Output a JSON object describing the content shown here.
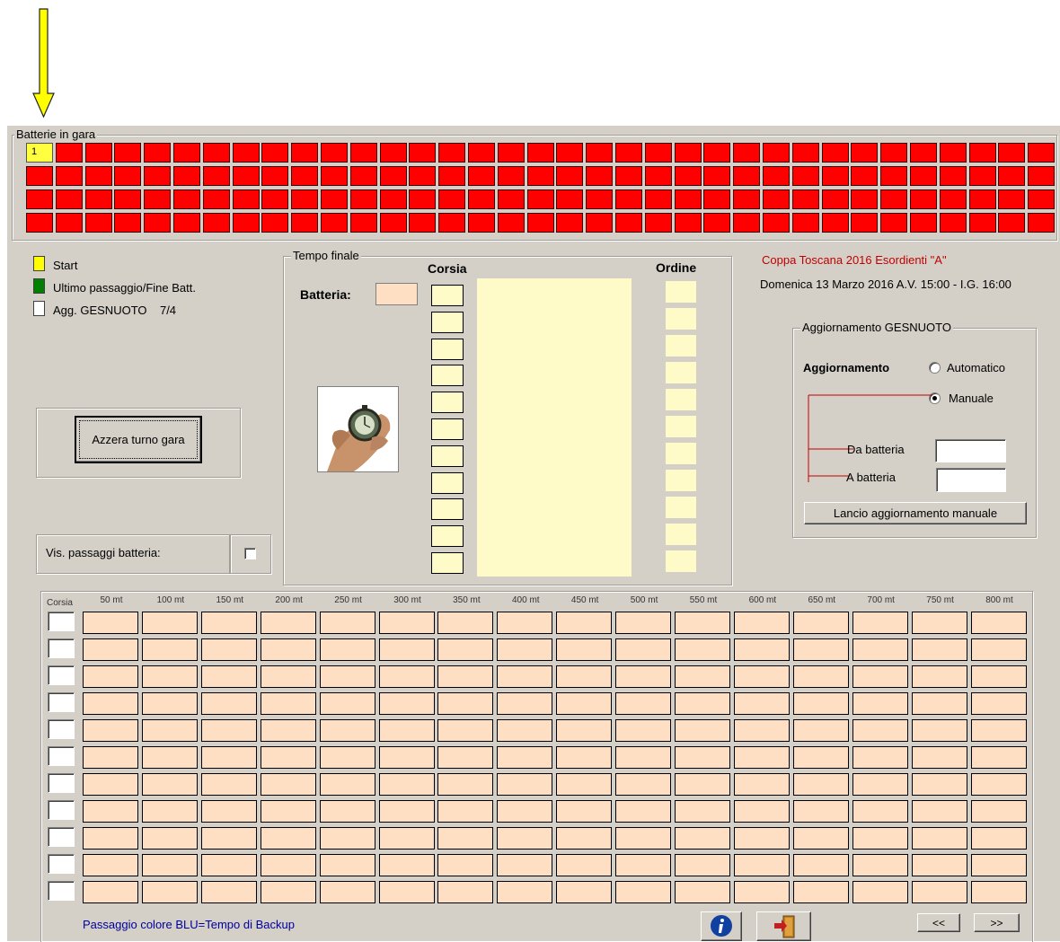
{
  "heats": {
    "title": "Batterie in gara",
    "current": "1",
    "rows": 4,
    "cols": 35
  },
  "legend": [
    {
      "color": "#ffff00",
      "label": "Start"
    },
    {
      "color": "#008000",
      "label": "Ultimo passaggio/Fine Batt."
    },
    {
      "color": "#ffffff",
      "label": "Agg. GESNUOTO    7/4"
    }
  ],
  "reset_button": "Azzera turno gara",
  "final_time": {
    "title": "Tempo finale",
    "battery_label": "Batteria:",
    "lane_header": "Corsia",
    "order_header": "Ordine",
    "lanes": 11
  },
  "event": {
    "title": "Coppa Toscana 2016 Esordienti \"A\"",
    "date": "Domenica 13 Marzo 2016 A.V. 15:00 - I.G. 16:00"
  },
  "update_panel": {
    "title": "Aggiornamento GESNUOTO",
    "label": "Aggiornamento",
    "options": [
      "Automatico",
      "Manuale"
    ],
    "selected": "Manuale",
    "from_label": "Da batteria",
    "to_label": "A batteria",
    "from_value": "",
    "to_value": "",
    "launch_button": "Lancio aggiornamento manuale"
  },
  "splits_toggle": {
    "label": "Vis. passaggi batteria:",
    "checked": false
  },
  "splits": {
    "lane_header": "Corsia",
    "distances": [
      "50 mt",
      "100 mt",
      "150 mt",
      "200 mt",
      "250 mt",
      "300 mt",
      "350 mt",
      "400 mt",
      "450 mt",
      "500 mt",
      "550 mt",
      "600 mt",
      "650 mt",
      "700 mt",
      "750 mt",
      "800 mt"
    ],
    "lanes": 11
  },
  "footer_note": "Passaggio colore BLU=Tempo di Backup",
  "nav": {
    "prev": "<<",
    "next": ">>"
  },
  "icons": {
    "arrow": "arrow-down-icon",
    "stopwatch": "stopwatch-icon",
    "info": "info-icon",
    "exit": "exit-door-icon"
  }
}
